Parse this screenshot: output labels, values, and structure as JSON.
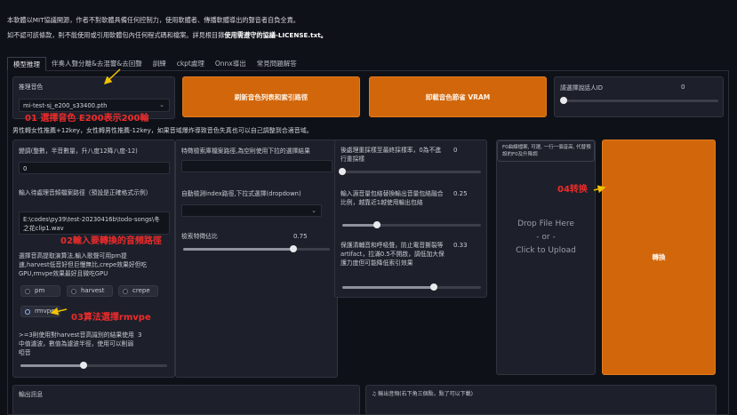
{
  "notice": {
    "line1": "本軟體以MIT協議開源，作者不對軟體具備任何控制力，使用軟體者、傳播軟體導出的聲音者自負全責。",
    "line2_prefix": "如不認可該條款，則不能使用或引用軟體包內任何程式碼和檔案。詳見根目錄",
    "line2_bold": "使用需遵守的協議",
    "line2_suffix": "-LICENSE.txt。"
  },
  "tabs": [
    "模型推理",
    "伴奏人聲分離&去混響&去回聲",
    "訓練",
    "ckpt處理",
    "Onnx導出",
    "常見問題解答"
  ],
  "infer": {
    "model_label": "推理音色",
    "model_value": "mi-test-sj_e200_s33400.pth",
    "refresh_button": "刷新音色列表和索引路徑",
    "unload_button": "卸載音色節省 VRAM",
    "speaker_label": "請選擇說話人ID",
    "speaker_value": "0",
    "hint": "男性轉女性推薦+12key，女性轉男性推薦-12key，如果音域爆炸導致音色失真也可以自己調整到合適音域。",
    "transpose_label": "變調(整數，半音數量，升八度12降八度-12)",
    "transpose_value": "0",
    "input_path_label": "輸入待處理音頻檔案路徑（預設是正確格式示例）",
    "input_path_value": "E:\\codes\\py39\\test-20230416b\\todo-songs\\冬之花clip1.wav",
    "f0_method_label": "選擇音高提取演算法,輸入歌聲可用pm提速,harvest低音好但巨慢無比,crepe效果好但吃GPU,rmvpe效果最好且微吃GPU",
    "f0_options": [
      "pm",
      "harvest",
      "crepe",
      "rmvpe"
    ],
    "filter_label": ">=3則使用對harvest音高識別的結果使用中值濾波，數值為濾波半徑，使用可以削弱啞音",
    "filter_value": "3",
    "filter_fraction": 0.43,
    "feature_path_label": "特徵檢索庫檔案路徑,為空則使用下拉的選擇結果",
    "auto_index_label": "自動檢測index路徑,下拉式選擇(dropdown)",
    "index_rate_label": "檢索特徵佔比",
    "index_rate_value": "0.75",
    "index_rate_fraction": 0.75,
    "resample_label": "後處理重採樣至最終採樣率，0為不進行重採樣",
    "resample_value": "0",
    "resample_fraction": 0.0,
    "rms_label": "輸入源音量包絡替換輸出音量包絡融合比例，越靠近1越使用輸出包絡",
    "rms_value": "0.25",
    "rms_fraction": 0.25,
    "protect_label": "保護清輔音和呼吸聲，防止電音撕裂等artifact，拉滿0.5不開啟，調低加大保護力度但可能降低索引效果",
    "protect_value": "0.33",
    "protect_fraction": 0.66,
    "f0_file_label": "F0曲線檔案, 可選, 一行一個音高, 代替預設的F0及升降調",
    "upload_line1": "Drop File Here",
    "upload_line2": "- or -",
    "upload_line3": "Click to Upload",
    "convert_button": "轉換",
    "output_info_label": "輸出訊息",
    "output_audio_label": "輸出音頻(右下角三個點，點了可以下載)"
  },
  "annotations": {
    "a1": "01 選擇音色 E200表示200輪",
    "a2": "02輸入要轉換的音頻路徑",
    "a3": "03算法選擇rmvpe",
    "a4": "04转换"
  },
  "colors": {
    "accent_orange": "#d2660b",
    "annotation_red": "#ee2b2b",
    "radio_selected": "#2f6bea"
  }
}
